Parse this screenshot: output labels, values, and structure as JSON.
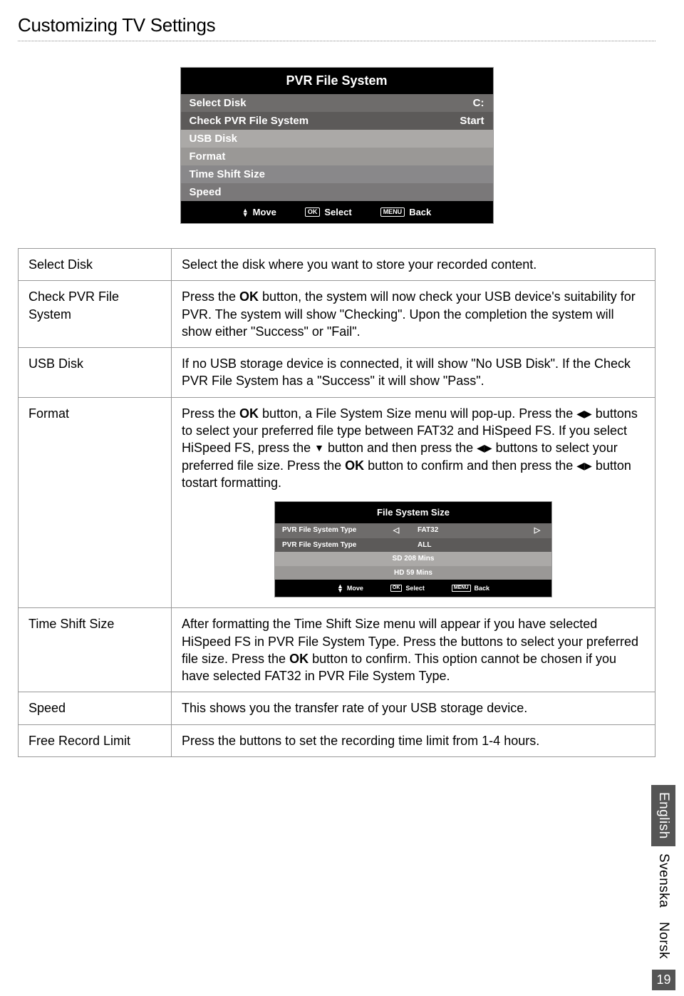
{
  "page_title": "Customizing TV Settings",
  "panel1": {
    "title": "PVR File System",
    "rows": [
      {
        "label": "Select Disk",
        "value": "C:"
      },
      {
        "label": "Check PVR File System",
        "value": "Start"
      },
      {
        "label": "USB Disk",
        "value": ""
      },
      {
        "label": "Format",
        "value": ""
      },
      {
        "label": "Time Shift Size",
        "value": ""
      },
      {
        "label": "Speed",
        "value": ""
      }
    ],
    "footer": {
      "move": "Move",
      "ok": "OK",
      "select": "Select",
      "menu": "MENU",
      "back": "Back"
    }
  },
  "table": {
    "select_disk": {
      "label": "Select Disk",
      "text": "Select the disk where you want to store your recorded content."
    },
    "check_pvr": {
      "label": "Check PVR File System",
      "pre": "Press the ",
      "ok": "OK",
      "post": " button, the system will now check your USB device's suitability for PVR. The system will show \"Checking\". Upon the completion the system will show either \"Success\" or \"Fail\"."
    },
    "usb_disk": {
      "label": "USB Disk",
      "text": "If no USB storage device is connected, it will show \"No USB Disk\". If the Check PVR File System has a \"Success\" it will show \"Pass\"."
    },
    "format": {
      "label": "Format",
      "s1a": "Press the ",
      "ok1": "OK",
      "s1b": " button, a File System Size menu will pop-up. Press the ",
      "lr1": "◀▶",
      "s1c": " buttons to select your preferred file type between FAT32 and HiSpeed FS. If you select HiSpeed FS, press the ",
      "down": "▼",
      "s1d": " button and then press the ",
      "lr2": "◀▶",
      "s1e": " buttons to select your preferred file size. Press the ",
      "ok2": "OK",
      "s1f": " button to confirm and then press the ",
      "lr3": "◀▶",
      "s1g": " button tostart formatting."
    },
    "time_shift": {
      "label": "Time Shift Size",
      "s1": "After formatting the Time Shift Size menu will appear if you have selected HiSpeed FS in PVR File System Type. Press the buttons to select your preferred file size. Press the ",
      "ok": "OK",
      "s2": " button to confirm. This option cannot be chosen if you have selected FAT32 in PVR File System Type."
    },
    "speed": {
      "label": "Speed",
      "text": "This shows you the transfer rate of your USB storage device."
    },
    "free_record": {
      "label": "Free Record Limit",
      "text": "Press the buttons to set the recording time limit from 1-4 hours."
    }
  },
  "panel2": {
    "title": "File  System Size",
    "rows": [
      {
        "label": "PVR File System Type",
        "value": "FAT32",
        "arrows": true
      },
      {
        "label": "PVR File System Type",
        "value": "ALL",
        "arrows": false
      }
    ],
    "sd": "SD  208  Mins",
    "hd": "HD   59  Mins",
    "footer": {
      "move": "Move",
      "ok": "OK",
      "select": "Select",
      "menu": "MENU",
      "back": "Back"
    }
  },
  "side_tabs": {
    "english": "English",
    "svenska": "Svenska",
    "norsk": "Norsk"
  },
  "page_number": "19"
}
